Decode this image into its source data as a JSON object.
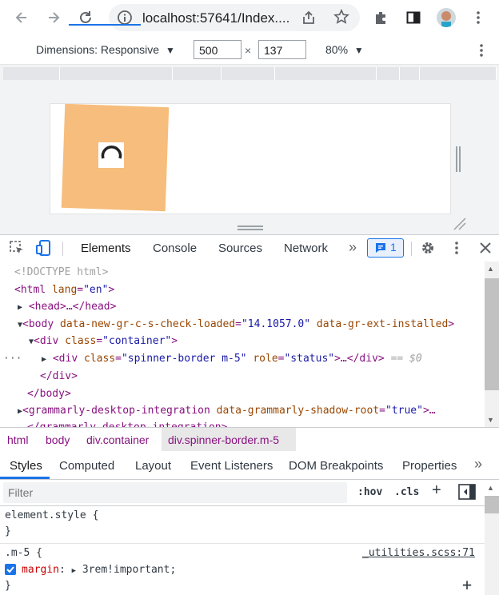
{
  "browser": {
    "url": "localhost:57641/Index....",
    "icons": [
      "back-arrow-icon",
      "forward-arrow-icon",
      "reload-icon",
      "info-icon",
      "share-icon",
      "star-icon",
      "extensions-icon",
      "sidepanel-icon",
      "avatar",
      "kebab-menu-icon"
    ]
  },
  "device_toolbar": {
    "dimensions_label": "Dimensions: Responsive",
    "width": "500",
    "height": "137",
    "times": "×",
    "zoom": "80%"
  },
  "devtools": {
    "tabs": [
      "Elements",
      "Console",
      "Sources",
      "Network"
    ],
    "more": "»",
    "issues_count": "1",
    "dom": {
      "doctype": "<!DOCTYPE html>",
      "html_open": "<html",
      "html_attr_name": "lang",
      "html_attr_value": "\"en\"",
      "head": "<head>…</head>",
      "body_open": "<body",
      "body_attr1_name": "data-new-gr-c-s-check-loaded",
      "body_attr1_value": "\"14.1057.0\"",
      "body_attr2_name": "data-gr-ext-installed",
      "div_container_open": "<div",
      "div_container_attr": "class",
      "div_container_value": "\"container\"",
      "div_spinner_open": "<div",
      "div_spinner_class_attr": "class",
      "div_spinner_class_value": "\"spinner-border m-5\"",
      "div_spinner_role_attr": "role",
      "div_spinner_role_value": "\"status\"",
      "div_spinner_tail": ">…</div>",
      "selected_marker": "== $0",
      "div_close": "</div>",
      "body_close": "</body>",
      "grammarly_open": "<grammarly-desktop-integration",
      "grammarly_attr": "data-grammarly-shadow-root",
      "grammarly_value": "\"true\"",
      "grammarly_tail": ">…",
      "grammarly_close": "</grammarly-desktop-integration>",
      "dots": "···"
    },
    "breadcrumb": [
      "html",
      "body",
      "div.container",
      "div.spinner-border.m-5"
    ],
    "styles_tabs": [
      "Styles",
      "Computed",
      "Layout",
      "Event Listeners",
      "DOM Breakpoints",
      "Properties"
    ],
    "styles_more": "»",
    "filter_placeholder": "Filter",
    "hov": ":hov",
    "cls": ".cls",
    "plus": "+",
    "rules": {
      "element_style": "element.style {",
      "close_brace": "}",
      "m5_selector": ".m-5 {",
      "m5_source": "_utilities.scss:71",
      "m5_prop": "margin",
      "m5_colon": ":",
      "m5_value": "3rem!important;"
    }
  }
}
